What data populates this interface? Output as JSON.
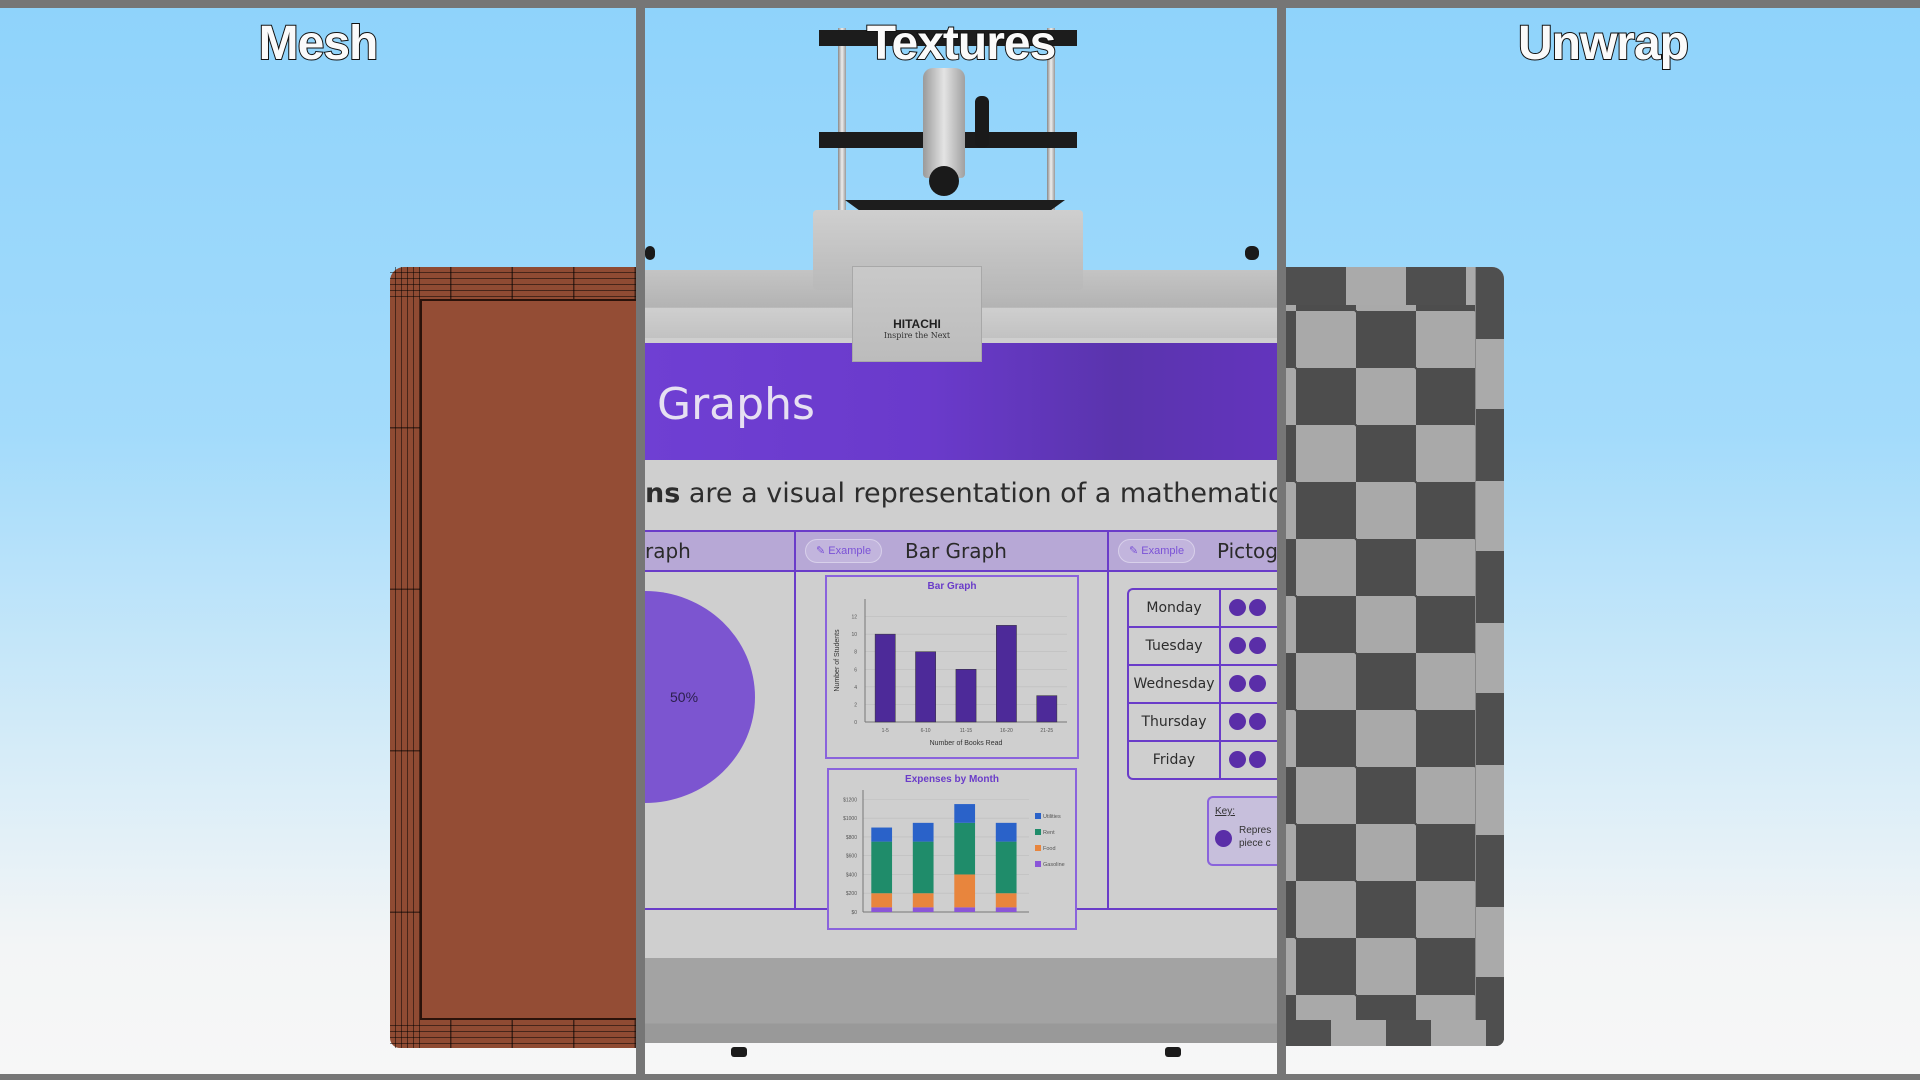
{
  "panels": {
    "mesh": {
      "title": "Mesh"
    },
    "textures": {
      "title": "Textures"
    },
    "unwrap": {
      "title": "Unwrap"
    }
  },
  "projector": {
    "brand": "HITACHI",
    "tagline": "Inspire the Next"
  },
  "board": {
    "header_title": "Graphs",
    "subtitle_bold": "ns",
    "subtitle_rest": " are a visual representation of a mathematical relations",
    "columns": [
      {
        "label": "raph",
        "example": ""
      },
      {
        "label": "Bar Graph",
        "example": "Example"
      },
      {
        "label": "Pictog",
        "example": "Example"
      }
    ],
    "pie_label": "50%",
    "key": {
      "title": "Key:",
      "text_line1": "Repres",
      "text_line2": "piece c"
    },
    "pictogram": {
      "days": [
        "Monday",
        "Tuesday",
        "Wednesday",
        "Thursday",
        "Friday"
      ]
    }
  },
  "colors": {
    "purple_header": "#6a3acb",
    "bar_fill": "#4d2a99",
    "utilities": "#2a62c9",
    "rent": "#1f8c6a",
    "food": "#e8853d",
    "gasoline": "#8a55d8"
  },
  "chart_data": [
    {
      "type": "bar",
      "title": "Bar Graph",
      "xlabel": "Number of Books Read",
      "ylabel": "Number of Students",
      "categories": [
        "1-5",
        "6-10",
        "11-15",
        "16-20",
        "21-25"
      ],
      "values": [
        10,
        8,
        6,
        11,
        3
      ],
      "yticks": [
        "0",
        "2",
        "4",
        "6",
        "8",
        "10",
        "12"
      ],
      "ylim": [
        0,
        14
      ]
    },
    {
      "type": "bar",
      "stacked": true,
      "title": "Expenses by Month",
      "categories": [
        "",
        "",
        "",
        ""
      ],
      "yticks": [
        "$0",
        "$200",
        "$400",
        "$600",
        "$800",
        "$1000",
        "$1200"
      ],
      "ylim": [
        0,
        1300
      ],
      "series": [
        {
          "name": "Gasoline",
          "values": [
            50,
            50,
            50,
            50
          ]
        },
        {
          "name": "Food",
          "values": [
            150,
            150,
            350,
            150
          ]
        },
        {
          "name": "Rent",
          "values": [
            550,
            550,
            550,
            550
          ]
        },
        {
          "name": "Utilities",
          "values": [
            150,
            200,
            200,
            200
          ]
        }
      ],
      "legend": [
        "Utilities",
        "Rent",
        "Food",
        "Gasoline"
      ],
      "legend_position": "right"
    }
  ]
}
